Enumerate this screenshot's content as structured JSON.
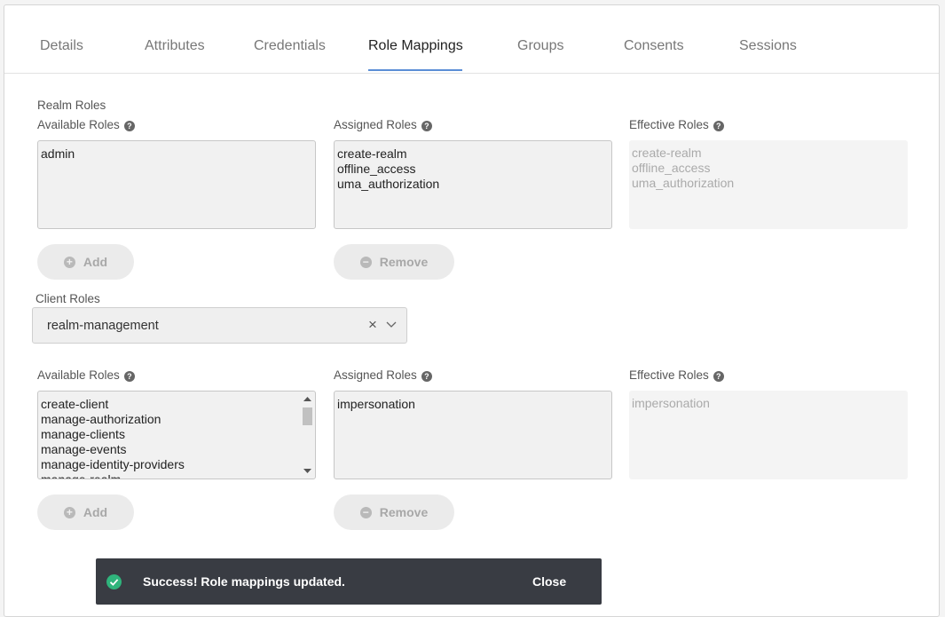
{
  "tabs": [
    {
      "label": "Details"
    },
    {
      "label": "Attributes"
    },
    {
      "label": "Credentials"
    },
    {
      "label": "Role Mappings",
      "active": true
    },
    {
      "label": "Groups"
    },
    {
      "label": "Consents"
    },
    {
      "label": "Sessions"
    }
  ],
  "realm": {
    "section_label": "Realm Roles",
    "available_label": "Available Roles",
    "assigned_label": "Assigned Roles",
    "effective_label": "Effective Roles",
    "available": [
      "admin"
    ],
    "assigned": [
      "create-realm",
      "offline_access",
      "uma_authorization"
    ],
    "effective": [
      "create-realm",
      "offline_access",
      "uma_authorization"
    ],
    "add_label": "Add",
    "remove_label": "Remove"
  },
  "client": {
    "section_label": "Client Roles",
    "selected_client": "realm-management",
    "available_label": "Available Roles",
    "assigned_label": "Assigned Roles",
    "effective_label": "Effective Roles",
    "available": [
      "create-client",
      "manage-authorization",
      "manage-clients",
      "manage-events",
      "manage-identity-providers",
      "manage-realm"
    ],
    "assigned": [
      "impersonation"
    ],
    "effective": [
      "impersonation"
    ],
    "add_label": "Add",
    "remove_label": "Remove"
  },
  "toast": {
    "message": "Success! Role mappings updated.",
    "close_label": "Close"
  },
  "icons": {
    "help": "question-circle-icon",
    "add": "plus-circle-icon",
    "remove": "minus-circle-icon",
    "clear": "close-icon",
    "dropdown": "chevron-down-icon",
    "success": "check-circle-icon"
  },
  "colors": {
    "active_tab_underline": "#5b8ed6",
    "toast_background": "#393c43",
    "success_icon": "#2fb47c"
  }
}
